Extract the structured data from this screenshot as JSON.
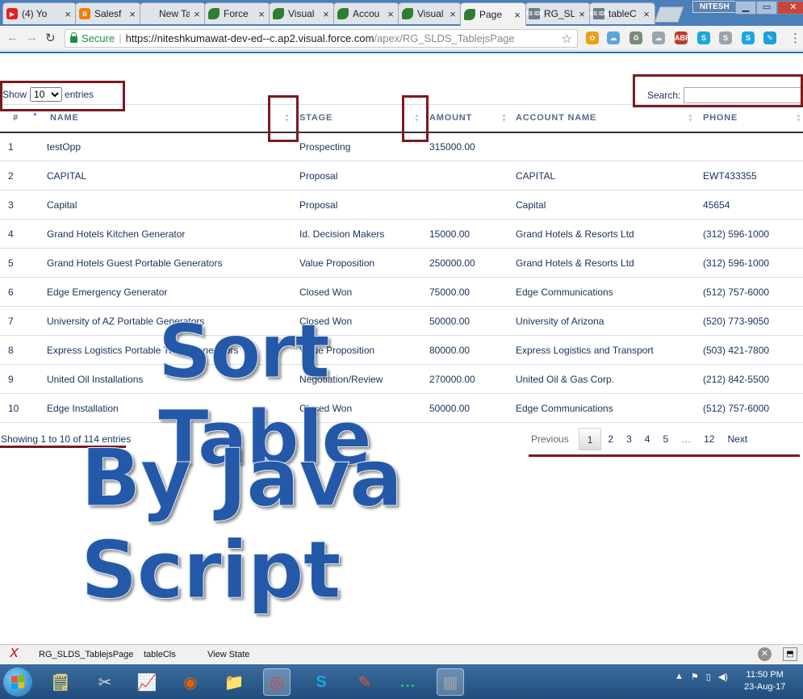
{
  "browser": {
    "tabs": [
      {
        "title": "(4) Yo",
        "fav": "yt",
        "glyph": "▶"
      },
      {
        "title": "Salesf",
        "fav": "blog",
        "glyph": "B"
      },
      {
        "title": "New Tab",
        "fav": "none",
        "glyph": ""
      },
      {
        "title": "Force",
        "fav": "leaf",
        "glyph": ""
      },
      {
        "title": "Visual",
        "fav": "leaf",
        "glyph": ""
      },
      {
        "title": "Accou",
        "fav": "leaf",
        "glyph": ""
      },
      {
        "title": "Visual",
        "fav": "leaf",
        "glyph": ""
      },
      {
        "title": "Page",
        "fav": "leaf",
        "glyph": "",
        "active": true
      },
      {
        "title": "RG_SL",
        "fav": "ide",
        "glyph": "AS IDE"
      },
      {
        "title": "tableC",
        "fav": "ide",
        "glyph": "AS IDE"
      }
    ],
    "tab_close": "×",
    "user": "NITESH",
    "window_buttons": {
      "minimize": "▁",
      "maximize": "▭",
      "close": "✕"
    },
    "nav": {
      "back": "←",
      "forward": "→",
      "reload": "↻"
    },
    "secure_label": "Secure",
    "separator": "|",
    "url_host": "https://niteshkumawat-dev-ed--c.ap2.visual.force.com",
    "url_path": "/apex/RG_SLDS_TablejsPage",
    "bookmark_star": "☆",
    "extensions": [
      {
        "label": "✿",
        "color": "#f39c12"
      },
      {
        "label": "☁",
        "color": "#5aa6d8"
      },
      {
        "label": "♻",
        "color": "#7a8a7a"
      },
      {
        "label": "☁",
        "color": "#9aa4ad"
      },
      {
        "label": "ABP",
        "color": "#c0392b"
      },
      {
        "label": "S",
        "color": "#1aa6e0"
      },
      {
        "label": "S",
        "color": "#9aa4ad"
      },
      {
        "label": "S",
        "color": "#1aa6e0"
      },
      {
        "label": "✎",
        "color": "#1a9fd8"
      },
      {
        "label": "•••",
        "color": "#2eb872"
      }
    ],
    "menu": "⋮"
  },
  "table": {
    "length_label_pre": "Show",
    "length_value": "10",
    "length_label_post": "entries",
    "search_label": "Search:",
    "search_value": "",
    "columns": [
      "#",
      "NAME",
      "STAGE",
      "AMOUNT",
      "ACCOUNT NAME",
      "PHONE"
    ],
    "sort_up": "▲",
    "sort_down": "▼",
    "rows": [
      [
        "1",
        "testOpp",
        "Prospecting",
        "315000.00",
        "",
        ""
      ],
      [
        "2",
        "CAPITAL",
        "Proposal",
        "",
        "CAPITAL",
        "EWT433355"
      ],
      [
        "3",
        "Capital",
        "Proposal",
        "",
        "Capital",
        "45654"
      ],
      [
        "4",
        "Grand Hotels Kitchen Generator",
        "Id. Decision Makers",
        "15000.00",
        "Grand Hotels & Resorts Ltd",
        "(312) 596-1000"
      ],
      [
        "5",
        "Grand Hotels Guest Portable Generators",
        "Value Proposition",
        "250000.00",
        "Grand Hotels & Resorts Ltd",
        "(312) 596-1000"
      ],
      [
        "6",
        "Edge Emergency Generator",
        "Closed Won",
        "75000.00",
        "Edge Communications",
        "(512) 757-6000"
      ],
      [
        "7",
        "University of AZ Portable Generators",
        "Closed Won",
        "50000.00",
        "University of Arizona",
        "(520) 773-9050"
      ],
      [
        "8",
        "Express Logistics Portable Truck Generators",
        "Value Proposition",
        "80000.00",
        "Express Logistics and Transport",
        "(503) 421-7800"
      ],
      [
        "9",
        "United Oil Installations",
        "Negotiation/Review",
        "270000.00",
        "United Oil & Gas Corp.",
        "(212) 842-5500"
      ],
      [
        "10",
        "Edge Installation",
        "Closed Won",
        "50000.00",
        "Edge Communications",
        "(512) 757-6000"
      ]
    ],
    "info": "Showing 1 to 10 of 114 entries",
    "pager": {
      "previous": "Previous",
      "pages": [
        "1",
        "2",
        "3",
        "4",
        "5"
      ],
      "current": "1",
      "ellipsis": "…",
      "last": "12",
      "next": "Next"
    }
  },
  "overlay": {
    "line1": "Sort Table",
    "line2": "By Java Script"
  },
  "devfooter": {
    "close_icon": "X",
    "links": [
      "RG_SLDS_TablejsPage",
      "tableCls",
      "View State"
    ],
    "help": "✕",
    "dock": "⬒"
  },
  "taskbar": {
    "apps": [
      {
        "glyph": "🗒",
        "color": "#e8d27a"
      },
      {
        "glyph": "✂",
        "color": "#cfd8e0"
      },
      {
        "glyph": "📈",
        "color": "#3fa34d"
      },
      {
        "glyph": "◉",
        "color": "#e66000"
      },
      {
        "glyph": "📁",
        "color": "#e8c46a"
      },
      {
        "glyph": "◎",
        "color": "#d64535",
        "active": true
      },
      {
        "glyph": "S",
        "color": "#1aa6e0"
      },
      {
        "glyph": "✎",
        "color": "#e05a2b"
      },
      {
        "glyph": "…",
        "color": "#2eb872"
      },
      {
        "glyph": "▦",
        "color": "#9aa4ad",
        "active": true
      }
    ],
    "tray": [
      "▲",
      "⚑",
      "▯",
      "◀)"
    ],
    "time": "11:50 PM",
    "date": "23-Aug-17"
  }
}
